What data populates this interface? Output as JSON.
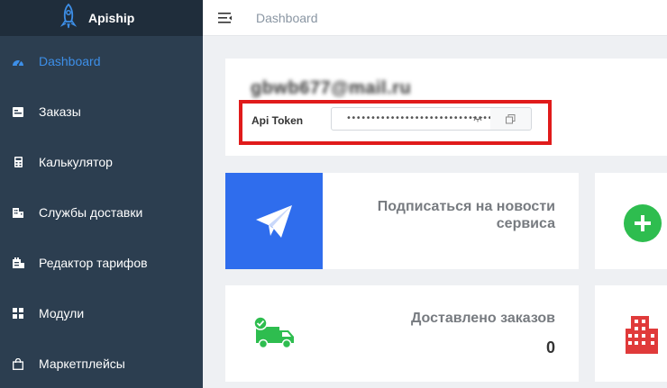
{
  "brand": {
    "name": "Apiship"
  },
  "sidebar": {
    "items": [
      {
        "label": "Dashboard",
        "icon": "dashboard-icon",
        "active": true
      },
      {
        "label": "Заказы",
        "icon": "orders-icon"
      },
      {
        "label": "Калькулятор",
        "icon": "calculator-icon"
      },
      {
        "label": "Службы доставки",
        "icon": "building-icon"
      },
      {
        "label": "Редактор тарифов",
        "icon": "tariff-icon"
      },
      {
        "label": "Модули",
        "icon": "modules-icon"
      },
      {
        "label": "Маркетплейсы",
        "icon": "shopping-bag-icon"
      }
    ]
  },
  "topbar": {
    "breadcrumb": "Dashboard"
  },
  "profile": {
    "email": "gbwb677@mail.ru",
    "token_label": "Api Token",
    "token_value": "••••••••••••••••••••••••••••••••"
  },
  "cards": {
    "subscribe": {
      "line1": "Подписаться на новости",
      "line2": "сервиса"
    },
    "delivered": {
      "label": "Доставлено заказов",
      "count": "0"
    }
  },
  "colors": {
    "sidebar": "#2c3e50",
    "accent": "#3d8fe8",
    "subscribe_bg": "#2f6ded",
    "success": "#2ebd4f",
    "danger": "#e03a3a",
    "highlight_border": "#e01b1b"
  }
}
